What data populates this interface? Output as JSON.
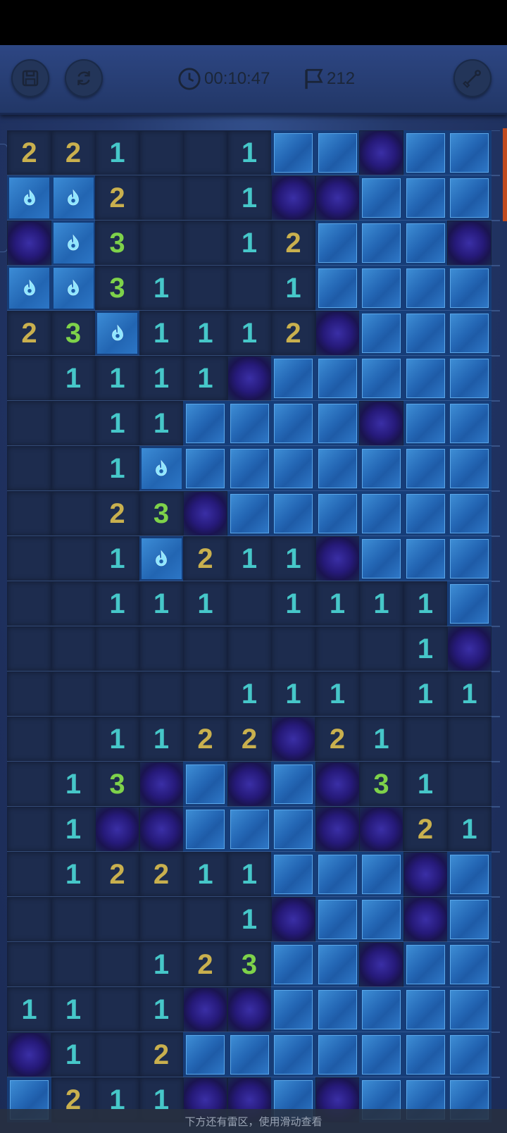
{
  "toolbar": {
    "save_icon": "save-icon",
    "restart_icon": "restart-icon",
    "timer": "00:10:47",
    "flags_remaining": "212",
    "tool_icon": "shovel-icon"
  },
  "colors": {
    "one": "#46c7c9",
    "two": "#c9b04e",
    "three": "#7ed24a",
    "covered": "#2467b5",
    "revealed": "#1d2c4e"
  },
  "board": {
    "columns": 11,
    "legend": "digits = revealed count, C = covered tile, M = mine, F = flag, . = empty revealed",
    "rows": [
      [
        "2",
        "2",
        "1",
        ".",
        ".",
        "1",
        "C",
        "C",
        "M",
        "C",
        "C"
      ],
      [
        "F",
        "F",
        "2",
        ".",
        ".",
        "1",
        "M",
        "M",
        "C",
        "C",
        "C"
      ],
      [
        "M",
        "F",
        "3",
        ".",
        ".",
        "1",
        "2",
        "C",
        "C",
        "C",
        "M"
      ],
      [
        "F",
        "F",
        "3",
        "1",
        ".",
        ".",
        "1",
        "C",
        "C",
        "C",
        "C"
      ],
      [
        "2",
        "3",
        "F",
        "1",
        "1",
        "1",
        "2",
        "M",
        "C",
        "C",
        "C"
      ],
      [
        ".",
        "1",
        "1",
        "1",
        "1",
        "M",
        "C",
        "C",
        "C",
        "C",
        "C"
      ],
      [
        ".",
        ".",
        "1",
        "1",
        "C",
        "C",
        "C",
        "C",
        "M",
        "C",
        "C"
      ],
      [
        ".",
        ".",
        "1",
        "F",
        "C",
        "C",
        "C",
        "C",
        "C",
        "C",
        "C"
      ],
      [
        ".",
        ".",
        "2",
        "3",
        "M",
        "C",
        "C",
        "C",
        "C",
        "C",
        "C"
      ],
      [
        ".",
        ".",
        "1",
        "F",
        "2",
        "1",
        "1",
        "M",
        "C",
        "C",
        "C"
      ],
      [
        ".",
        ".",
        "1",
        "1",
        "1",
        ".",
        "1",
        "1",
        "1",
        "1",
        "C"
      ],
      [
        ".",
        ".",
        ".",
        ".",
        ".",
        ".",
        ".",
        ".",
        ".",
        "1",
        "M"
      ],
      [
        ".",
        ".",
        ".",
        ".",
        ".",
        "1",
        "1",
        "1",
        ".",
        "1",
        "1"
      ],
      [
        ".",
        ".",
        "1",
        "1",
        "2",
        "2",
        "M",
        "2",
        "1",
        ".",
        "."
      ],
      [
        ".",
        "1",
        "3",
        "M",
        "C",
        "M",
        "C",
        "M",
        "3",
        "1",
        "."
      ],
      [
        ".",
        "1",
        "M",
        "M",
        "C",
        "C",
        "C",
        "M",
        "M",
        "2",
        "1"
      ],
      [
        ".",
        "1",
        "2",
        "2",
        "1",
        "1",
        "C",
        "C",
        "C",
        "M",
        "C"
      ],
      [
        ".",
        ".",
        ".",
        ".",
        ".",
        "1",
        "M",
        "C",
        "C",
        "M",
        "C"
      ],
      [
        ".",
        ".",
        ".",
        "1",
        "2",
        "3",
        "C",
        "C",
        "M",
        "C",
        "C"
      ],
      [
        "1",
        "1",
        ".",
        "1",
        "M",
        "M",
        "C",
        "C",
        "C",
        "C",
        "C"
      ],
      [
        "M",
        "1",
        ".",
        "2",
        "C",
        "C",
        "C",
        "C",
        "C",
        "C",
        "C"
      ],
      [
        "C",
        "2",
        "1",
        "1",
        "M",
        "M",
        "C",
        "M",
        "C",
        "C",
        "C"
      ]
    ]
  },
  "hint": "下方还有雷区，使用滑动查看"
}
